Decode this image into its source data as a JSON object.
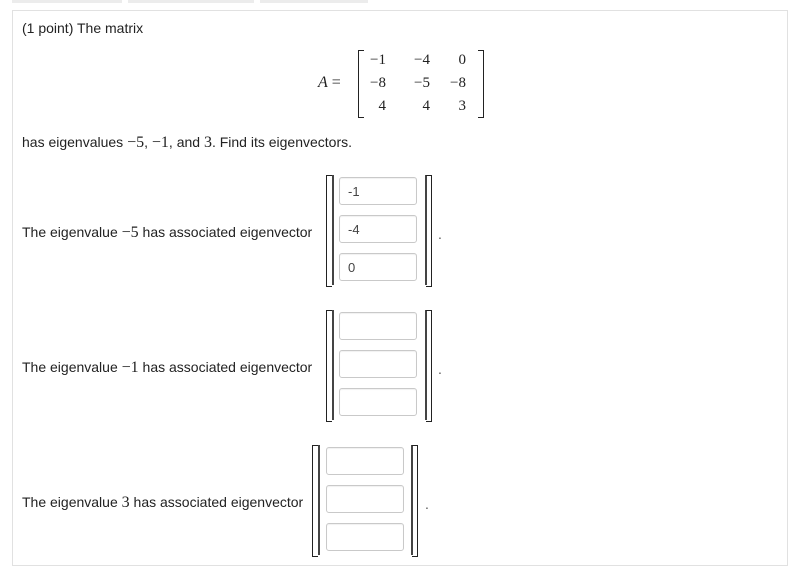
{
  "problem": {
    "points_label": "(1 point) The matrix",
    "matrix_var": "A",
    "equals": "=",
    "matrix": [
      [
        "−1",
        "−4",
        "0"
      ],
      [
        "−8",
        "−5",
        "−8"
      ],
      [
        "4",
        "4",
        "3"
      ]
    ],
    "eig_prefix": "has eigenvalues ",
    "eig_vals": [
      "−5",
      "−1",
      "3"
    ],
    "eig_sep1": ", ",
    "eig_sep2": ", and ",
    "eig_suffix": ". Find its eigenvectors."
  },
  "questions": [
    {
      "label_before": "The eigenvalue ",
      "eigenvalue": "−5",
      "label_after": " has associated eigenvector",
      "inputs": [
        "-1",
        "-4",
        "0"
      ],
      "period": "."
    },
    {
      "label_before": "The eigenvalue ",
      "eigenvalue": "−1",
      "label_after": " has associated eigenvector",
      "inputs": [
        "",
        "",
        ""
      ],
      "period": "."
    },
    {
      "label_before": "The eigenvalue ",
      "eigenvalue": "3",
      "label_after": " has associated eigenvector",
      "inputs": [
        "",
        "",
        ""
      ],
      "period": "."
    }
  ]
}
